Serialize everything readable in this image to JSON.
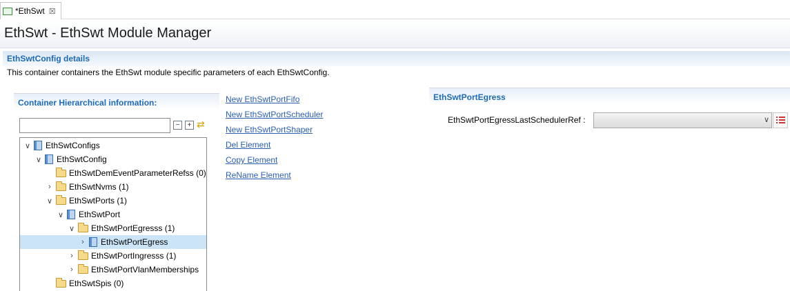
{
  "tab": {
    "label": "*EthSwt",
    "close_glyph": "☒",
    "icon": "file-icon"
  },
  "header": {
    "title": "EthSwt - EthSwt Module Manager"
  },
  "section": {
    "title": "EthSwtConfig details",
    "description": "This container containers the EthSwt module specific parameters of each EthSwtConfig."
  },
  "left_panel": {
    "title": "Container Hierarchical information:",
    "filter_value": "",
    "tools": {
      "collapse_glyph": "−",
      "expand_glyph": "+",
      "sync_glyph": "⇄"
    }
  },
  "tree": {
    "items": [
      {
        "label": "EthSwtConfigs",
        "twisty": "∨",
        "icon": "module-icon"
      },
      {
        "label": "EthSwtConfig",
        "twisty": "∨",
        "icon": "module-icon"
      },
      {
        "label": "EthSwtDemEventParameterRefss (0)",
        "twisty": "",
        "icon": "folder-icon"
      },
      {
        "label": "EthSwtNvms (1)",
        "twisty": "›",
        "icon": "folder-icon"
      },
      {
        "label": "EthSwtPorts (1)",
        "twisty": "∨",
        "icon": "folder-icon"
      },
      {
        "label": "EthSwtPort",
        "twisty": "∨",
        "icon": "module-icon"
      },
      {
        "label": "EthSwtPortEgresss (1)",
        "twisty": "∨",
        "icon": "folder-icon"
      },
      {
        "label": "EthSwtPortEgress",
        "twisty": "›",
        "icon": "module-icon",
        "selected": true
      },
      {
        "label": "EthSwtPortIngresss (1)",
        "twisty": "›",
        "icon": "folder-icon"
      },
      {
        "label": "EthSwtPortVlanMemberships",
        "twisty": "›",
        "icon": "folder-icon"
      },
      {
        "label": "EthSwtSpis (0)",
        "twisty": "",
        "icon": "folder-icon"
      }
    ]
  },
  "actions": {
    "new_fifo": "New EthSwtPortFifo",
    "new_scheduler": "New EthSwtPortScheduler",
    "new_shaper": "New EthSwtPortShaper",
    "del_element": "Del Element",
    "copy_element": "Copy Element",
    "rename_element": "ReName Element"
  },
  "details": {
    "title": "EthSwtPortEgress",
    "property_label": "EthSwtPortEgressLastSchedulerRef :",
    "property_value": "",
    "combo_arrow": "∨"
  },
  "colors": {
    "accent": "#1e6ab4",
    "link": "#2b5fb0",
    "selection": "#cce4f7"
  }
}
